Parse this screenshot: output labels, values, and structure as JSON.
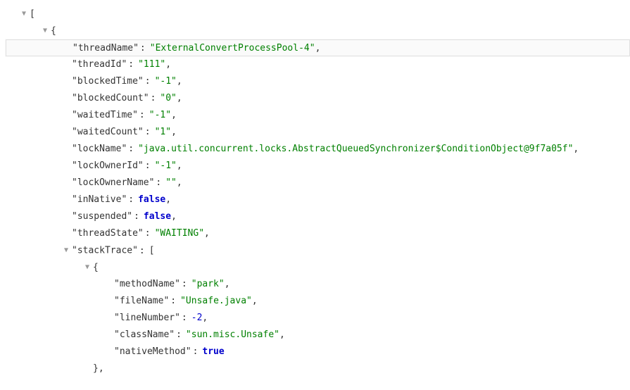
{
  "json": {
    "root_open": "[",
    "obj_open": "{",
    "obj_close": "}",
    "arr_open": "[",
    "comma": ",",
    "fields": [
      {
        "key": "\"threadName\"",
        "value": "\"ExternalConvertProcessPool-4\"",
        "type": "string",
        "highlighted": true
      },
      {
        "key": "\"threadId\"",
        "value": "\"111\"",
        "type": "string"
      },
      {
        "key": "\"blockedTime\"",
        "value": "\"-1\"",
        "type": "string"
      },
      {
        "key": "\"blockedCount\"",
        "value": "\"0\"",
        "type": "string"
      },
      {
        "key": "\"waitedTime\"",
        "value": "\"-1\"",
        "type": "string"
      },
      {
        "key": "\"waitedCount\"",
        "value": "\"1\"",
        "type": "string"
      },
      {
        "key": "\"lockName\"",
        "value": "\"java.util.concurrent.locks.AbstractQueuedSynchronizer$ConditionObject@9f7a05f\"",
        "type": "string"
      },
      {
        "key": "\"lockOwnerId\"",
        "value": "\"-1\"",
        "type": "string"
      },
      {
        "key": "\"lockOwnerName\"",
        "value": "\"\"",
        "type": "string"
      },
      {
        "key": "\"inNative\"",
        "value": "false",
        "type": "bool"
      },
      {
        "key": "\"suspended\"",
        "value": "false",
        "type": "bool"
      },
      {
        "key": "\"threadState\"",
        "value": "\"WAITING\"",
        "type": "string"
      }
    ],
    "stackTraceKey": "\"stackTrace\"",
    "stackItem": [
      {
        "key": "\"methodName\"",
        "value": "\"park\"",
        "type": "string"
      },
      {
        "key": "\"fileName\"",
        "value": "\"Unsafe.java\"",
        "type": "string"
      },
      {
        "key": "\"lineNumber\"",
        "value": "-2",
        "type": "number"
      },
      {
        "key": "\"className\"",
        "value": "\"sun.misc.Unsafe\"",
        "type": "string"
      },
      {
        "key": "\"nativeMethod\"",
        "value": "true",
        "type": "bool",
        "last": true
      }
    ],
    "stackItemClose": "},"
  },
  "glyphs": {
    "expanded": "▼"
  }
}
